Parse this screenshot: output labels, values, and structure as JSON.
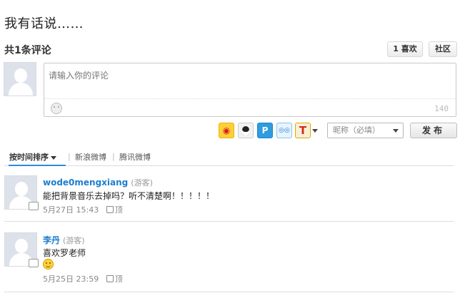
{
  "page": {
    "title": "我有话说……"
  },
  "header": {
    "count_title": "共1条评论",
    "like_label": "1 喜欢",
    "community_label": "社区"
  },
  "editor": {
    "placeholder": "请输入你的评论",
    "char_count": "140",
    "emoji_icon": "smiley-icon"
  },
  "share": {
    "icons": [
      "sina-weibo-icon",
      "qq-icon",
      "pengyou-icon",
      "qzone-icon",
      "tencent-weibo-icon"
    ],
    "tencent_glyph": "T"
  },
  "form": {
    "nickname_label": "昵称（必填）",
    "publish_label": "发布"
  },
  "tabs": {
    "time_label": "按时间排序",
    "sina_label": "新浪微博",
    "tencent_label": "腾讯微博",
    "separator": "|"
  },
  "comments": [
    {
      "user": "wode0mengxiang",
      "role": "(游客)",
      "text": "能把背景音乐去掉吗？听不清楚啊！！！！！",
      "date": "5月27日 15:43",
      "up_label": "顶"
    },
    {
      "user": "李丹",
      "role": "(游客)",
      "text": "喜欢罗老师",
      "has_emoji": true,
      "date": "5月25日 23:59",
      "up_label": "顶"
    }
  ],
  "colors": {
    "link": "#1d7ecf",
    "tab_active_line": "#2d8ae0"
  }
}
